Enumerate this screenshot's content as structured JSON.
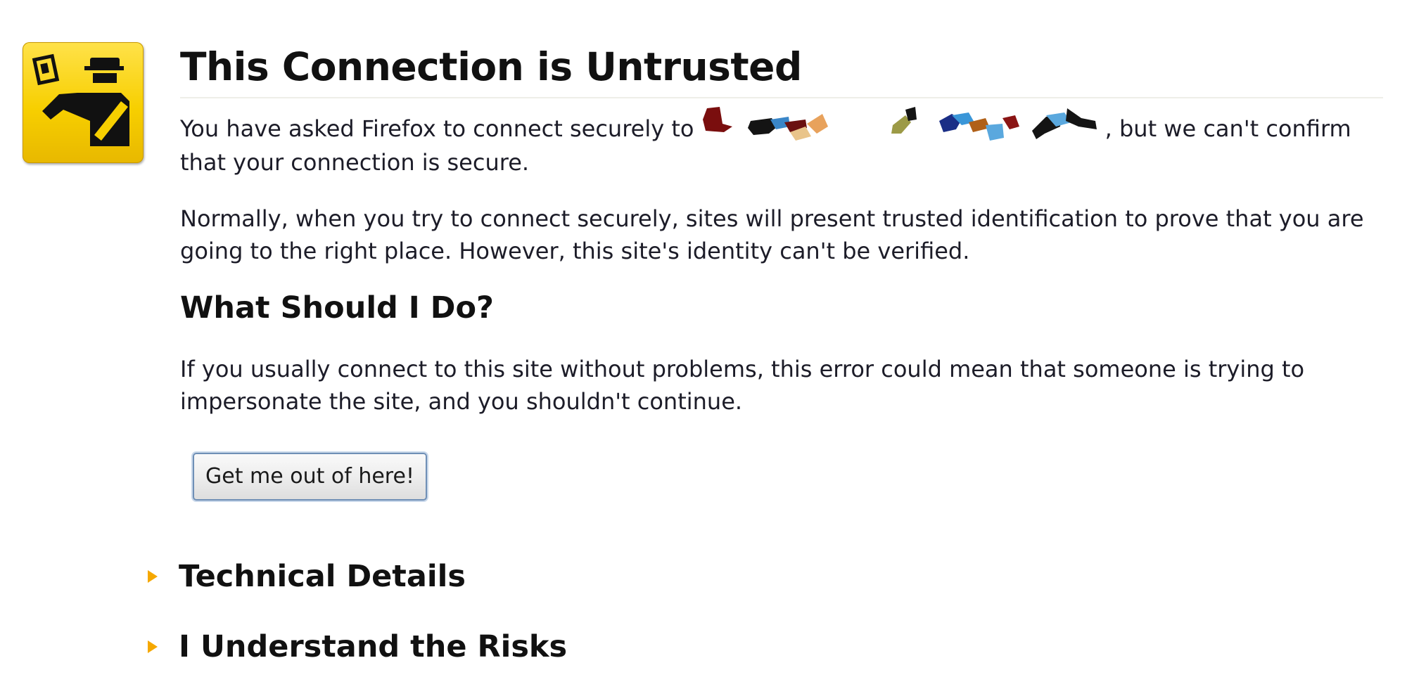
{
  "error_page": {
    "title": "This Connection is Untrusted",
    "intro_before_host": "You have asked Firefox to connect securely to ",
    "intro_after_host": ", but we can't confirm that your connection is secure.",
    "normally_text": "Normally, when you try to connect securely, sites will present trusted identification to prove that you are going to the right place. However, this site's identity can't be verified.",
    "what_heading": "What Should I Do?",
    "advice_text": "If you usually connect to this site without problems, this error could mean that someone is trying to impersonate the site, and you shouldn't continue.",
    "escape_button_label": "Get me out of here!",
    "technical_details_label": "Technical Details",
    "understand_risks_label": "I Understand the Risks"
  },
  "icons": {
    "main": "officer-icon",
    "expand": "triangle-right-icon"
  },
  "colors": {
    "icon_yellow": "#f7cf00",
    "triangle": "#f5a800",
    "button_border": "#6f8fb6"
  }
}
